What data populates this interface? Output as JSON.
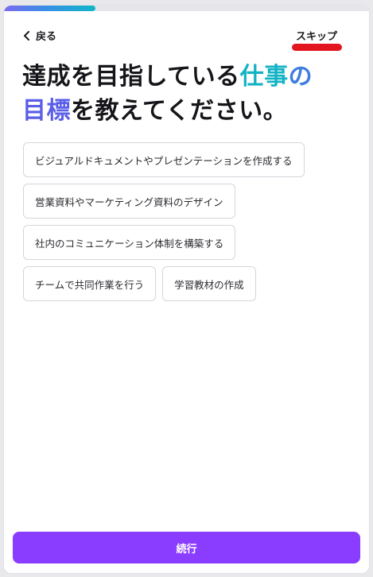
{
  "progress": {
    "fraction": 0.25
  },
  "header": {
    "back_label": "戻る",
    "skip_label": "スキップ"
  },
  "question": {
    "part1": "達成を目指している",
    "highlight_a": "仕事",
    "highlight_b": "の",
    "highlight_c": "目標",
    "part2": "を教えてください。"
  },
  "options": [
    "ビジュアルドキュメントやプレゼンテーションを作成する",
    "営業資料やマーケティング資料のデザイン",
    "社内のコミュニケーション体制を構築する",
    "チームで共同作業を行う",
    "学習教材の作成"
  ],
  "footer": {
    "continue_label": "続行"
  },
  "colors": {
    "accent": "#8b3dff",
    "highlight_teal": "#13b3c4",
    "highlight_blue": "#3d7ee0",
    "highlight_purple": "#5a5ee8",
    "annotation_red": "#e3161f"
  },
  "icons": {
    "back": "chevron-left-icon"
  }
}
